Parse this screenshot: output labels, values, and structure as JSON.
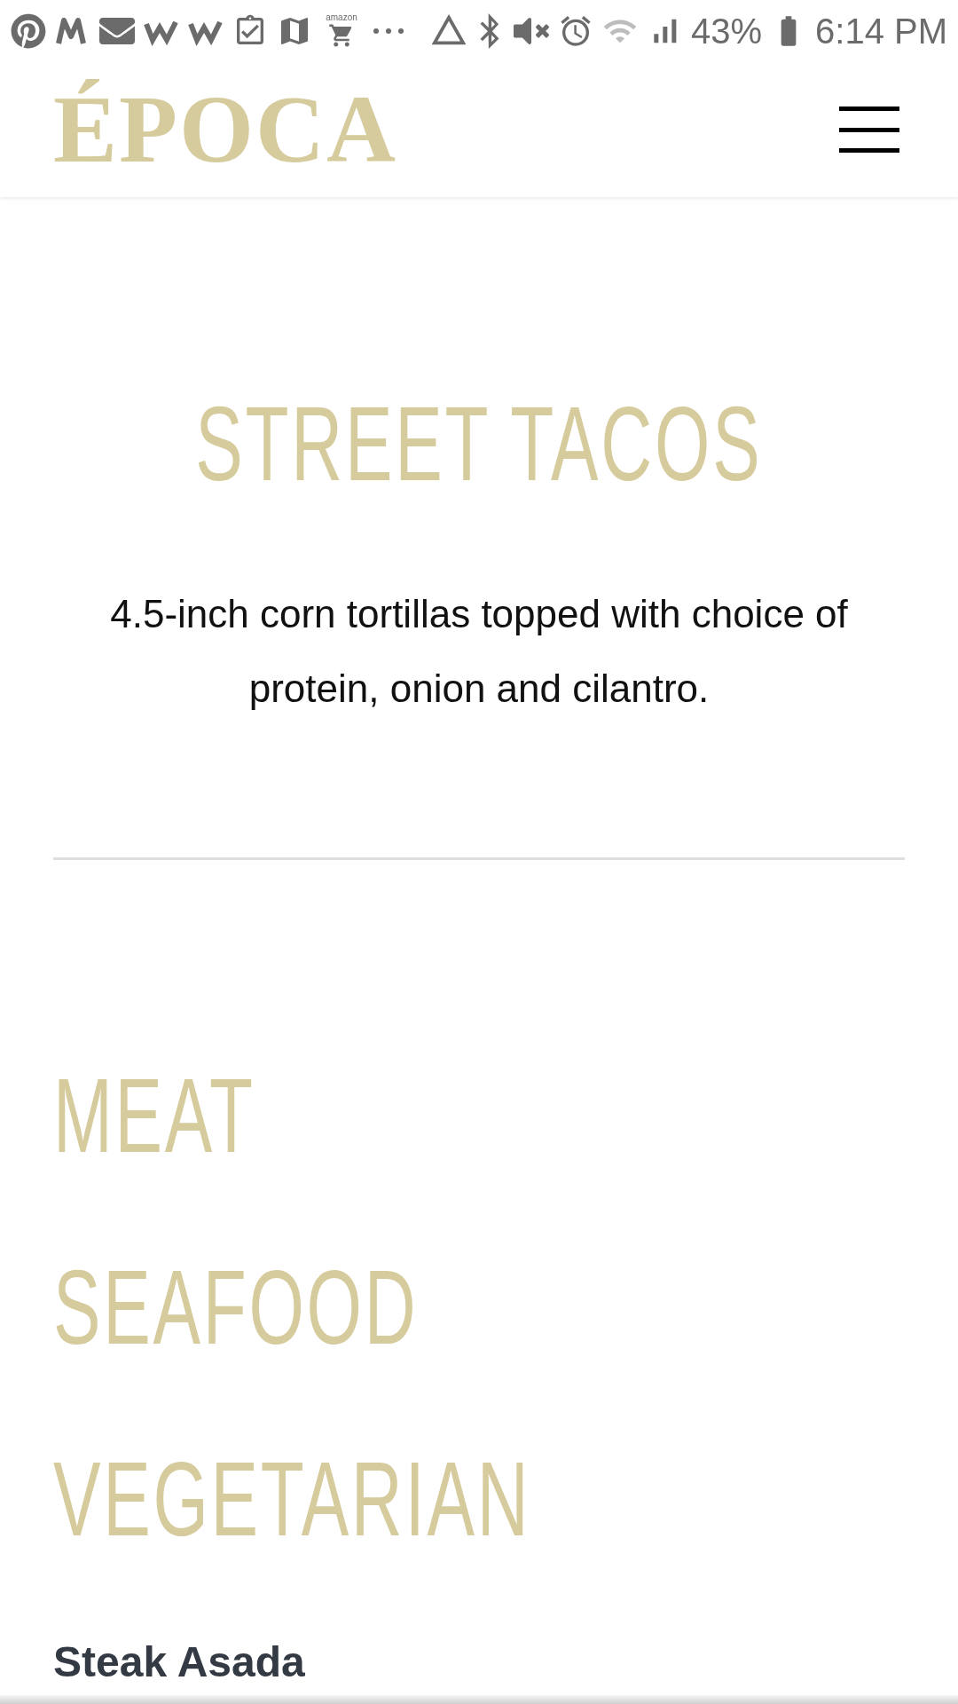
{
  "status_bar": {
    "battery": "43%",
    "time": "6:14 PM",
    "store_label": "amazon"
  },
  "header": {
    "logo": "ÉPOCA"
  },
  "section": {
    "title": "STREET TACOS",
    "description": "4.5-inch corn tortillas topped with choice of protein, onion and cilantro."
  },
  "categories": [
    {
      "label": "MEAT"
    },
    {
      "label": "SEAFOOD"
    },
    {
      "label": "VEGETARIAN"
    }
  ],
  "items": [
    {
      "name": "Steak Asada"
    }
  ]
}
